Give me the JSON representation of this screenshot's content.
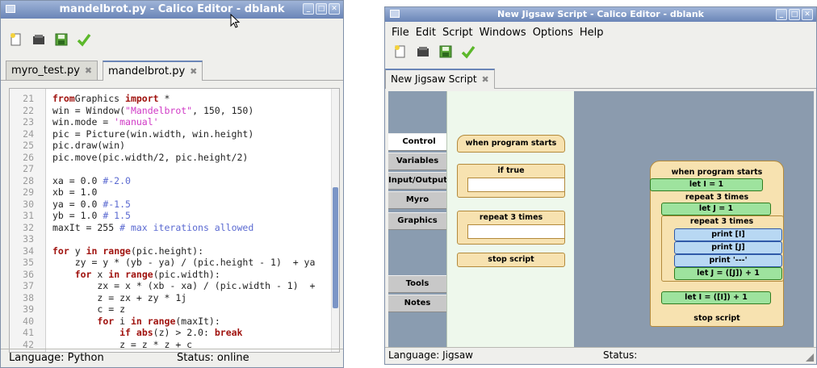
{
  "left_window": {
    "title": "mandelbrot.py - Calico Editor - dblank",
    "tabs": [
      {
        "label": "myro_test.py",
        "close": "✖"
      },
      {
        "label": "mandelbrot.py",
        "close": "✖"
      }
    ],
    "code_lines": [
      {
        "n": "21",
        "parts": [
          [
            "kw",
            "from"
          ],
          [
            "",
            "Graphics "
          ],
          [
            "kw",
            "import"
          ],
          [
            "",
            " *"
          ]
        ]
      },
      {
        "n": "22",
        "parts": [
          [
            "",
            "win = Window("
          ],
          [
            "str",
            "\"Mandelbrot\""
          ],
          [
            "",
            ", 150, 150)"
          ]
        ]
      },
      {
        "n": "23",
        "parts": [
          [
            "",
            "win.mode = "
          ],
          [
            "str",
            "'manual'"
          ]
        ]
      },
      {
        "n": "24",
        "parts": [
          [
            "",
            "pic = Picture(win.width, win.height)"
          ]
        ]
      },
      {
        "n": "25",
        "parts": [
          [
            "",
            "pic.draw(win)"
          ]
        ]
      },
      {
        "n": "26",
        "parts": [
          [
            "",
            "pic.move(pic.width/2, pic.height/2)"
          ]
        ]
      },
      {
        "n": "27",
        "parts": []
      },
      {
        "n": "28",
        "parts": [
          [
            "",
            "xa = 0.0 "
          ],
          [
            "cm",
            "#-2.0"
          ]
        ]
      },
      {
        "n": "29",
        "parts": [
          [
            "",
            "xb = 1.0"
          ]
        ]
      },
      {
        "n": "30",
        "parts": [
          [
            "",
            "ya = 0.0 "
          ],
          [
            "cm",
            "#-1.5"
          ]
        ]
      },
      {
        "n": "31",
        "parts": [
          [
            "",
            "yb = 1.0 "
          ],
          [
            "cm",
            "# 1.5"
          ]
        ]
      },
      {
        "n": "32",
        "parts": [
          [
            "",
            "maxIt = 255 "
          ],
          [
            "cm",
            "# max iterations allowed"
          ]
        ]
      },
      {
        "n": "33",
        "parts": []
      },
      {
        "n": "34",
        "parts": [
          [
            "kw",
            "for"
          ],
          [
            "",
            " y "
          ],
          [
            "kw",
            "in"
          ],
          [
            "",
            " "
          ],
          [
            "kw",
            "range"
          ],
          [
            "",
            "(pic.height):"
          ]
        ]
      },
      {
        "n": "35",
        "parts": [
          [
            "",
            "    zy = y * (yb - ya) / (pic.height - 1)  + ya"
          ]
        ]
      },
      {
        "n": "36",
        "parts": [
          [
            "",
            "    "
          ],
          [
            "kw",
            "for"
          ],
          [
            "",
            " x "
          ],
          [
            "kw",
            "in"
          ],
          [
            "",
            " "
          ],
          [
            "kw",
            "range"
          ],
          [
            "",
            "(pic.width):"
          ]
        ]
      },
      {
        "n": "37",
        "parts": [
          [
            "",
            "        zx = x * (xb - xa) / (pic.width - 1)  +"
          ]
        ]
      },
      {
        "n": "38",
        "parts": [
          [
            "",
            "        z = zx + zy * 1j"
          ]
        ]
      },
      {
        "n": "39",
        "parts": [
          [
            "",
            "        c = z"
          ]
        ]
      },
      {
        "n": "40",
        "parts": [
          [
            "",
            "        "
          ],
          [
            "kw",
            "for"
          ],
          [
            "",
            " i "
          ],
          [
            "kw",
            "in"
          ],
          [
            "",
            " "
          ],
          [
            "kw",
            "range"
          ],
          [
            "",
            "(maxIt):"
          ]
        ]
      },
      {
        "n": "41",
        "parts": [
          [
            "",
            "            "
          ],
          [
            "kw",
            "if"
          ],
          [
            "",
            " "
          ],
          [
            "kw",
            "abs"
          ],
          [
            "",
            "(z) > 2.0: "
          ],
          [
            "kw",
            "break"
          ]
        ]
      },
      {
        "n": "42",
        "parts": [
          [
            "",
            "            z = z * z + c"
          ]
        ]
      }
    ],
    "status_language": "Language: Python",
    "status_state": "Status: online"
  },
  "right_window": {
    "title": "New Jigsaw Script - Calico Editor - dblank",
    "menu": [
      "File",
      "Edit",
      "Script",
      "Windows",
      "Options",
      "Help"
    ],
    "tab": {
      "label": "New Jigsaw Script",
      "close": "✖"
    },
    "categories": [
      "Control",
      "Variables",
      "Input/Output",
      "Myro",
      "Graphics"
    ],
    "categories_bottom": [
      "Tools",
      "Notes"
    ],
    "palette": {
      "when_program_starts": "when program starts",
      "if_true": "if true",
      "repeat_times": "repeat 3 times",
      "stop_script": "stop script"
    },
    "script": {
      "hat": "when program starts",
      "let_i": "let I = 1",
      "repeat_outer": "repeat 3 times",
      "let_j": "let J = 1",
      "repeat_inner": "repeat 3 times",
      "print_i": "print [I]",
      "print_j": "print [J]",
      "print_dash": "print '---'",
      "let_j_inc": "let J = ([J]) + 1",
      "let_i_inc": "let I = ([I]) + 1",
      "stop": "stop script"
    },
    "status_language": "Language: Jigsaw",
    "status_state": "Status:"
  }
}
